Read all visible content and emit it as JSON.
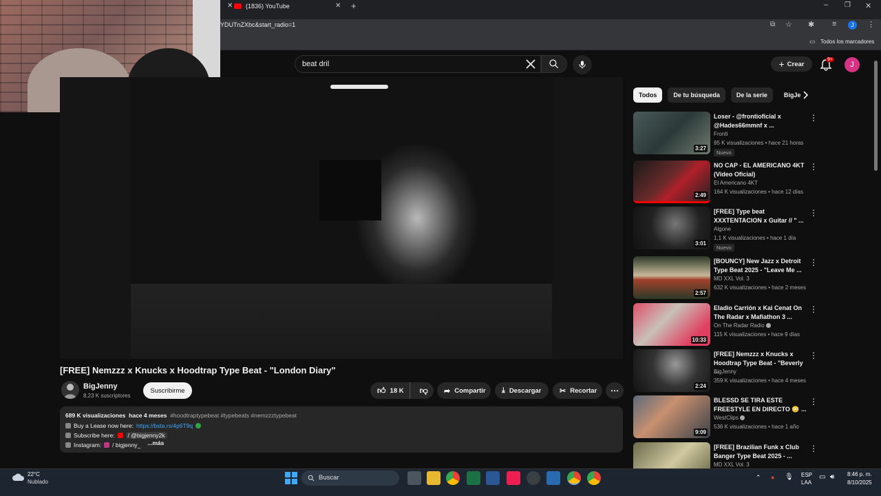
{
  "browser": {
    "tab_title": "(1836) YouTube",
    "url_fragment": "YDUTnZXbc&start_radio=1",
    "bookmarks_label": "Todos los marcadores",
    "profile_initial": "J"
  },
  "youtube": {
    "search_value": "beat dril",
    "create_label": "Crear",
    "notifications_badge": "9+",
    "avatar_initial": "J"
  },
  "video": {
    "title": "[FREE] Nemzzz x Knucks x Hoodtrap Type Beat - \"London Diary\"",
    "channel": "BigJenny",
    "subscribers": "8,23 K suscriptores",
    "subscribe_label": "Suscribirme",
    "likes": "18 K",
    "share_label": "Compartir",
    "download_label": "Descargar",
    "clip_label": "Recortar"
  },
  "description": {
    "views": "689 K visualizaciones",
    "date": "hace 4 meses",
    "tags": "#hoodtraptypebeat #typebeats #nemzzztypebeat",
    "line1_text": "Buy a Lease now here:",
    "line1_link": "https://bsta.rs/4p6T9q",
    "line2_text": "Subscribe here:",
    "line2_link": "/ @bigjenny2k",
    "line3_text": "Instagram:",
    "line3_link": "/ bigjenny_",
    "more": "...más"
  },
  "chips": [
    "Todos",
    "De tu búsqueda",
    "De la serie",
    "BigJe"
  ],
  "recommendations": [
    {
      "title": "Loser - @frontioficial x @Hades66mmnf x ...",
      "channel": "Fronti",
      "verified": false,
      "stats": "95 K visualizaciones • hace 21 horas",
      "duration": "3:27",
      "badge": "Nuevo"
    },
    {
      "title": "NO CAP - EL AMERICANO 4KT (Video Oficial)",
      "channel": "El Americano 4KT",
      "verified": false,
      "stats": "164 K visualizaciones • hace 12 días",
      "duration": "2:49",
      "badge": ""
    },
    {
      "title": "[FREE] Type beat XXXTENTACION x Guitar // \" ...",
      "channel": "Algone",
      "verified": false,
      "stats": "1,1 K visualizaciones • hace 1 día",
      "duration": "3:01",
      "badge": "Nuevo"
    },
    {
      "title": "[BOUNCY] New Jazz x Detroit Type Beat 2025 - \"Leave Me ...",
      "channel": "MD XXL Vol. 3",
      "verified": false,
      "stats": "632 K visualizaciones • hace 2 meses",
      "duration": "2:57",
      "badge": ""
    },
    {
      "title": "Eladio Carrión x Kai Cenat On The Radar x Mafiathon 3 ...",
      "channel": "On The Radar Radio",
      "verified": true,
      "stats": "115 K visualizaciones • hace 9 días",
      "duration": "10:33",
      "badge": ""
    },
    {
      "title": "[FREE] Nemzzz x Knucks x Hoodtrap Type Beat - \"Beverly ...",
      "channel": "BigJenny",
      "verified": false,
      "stats": "359 K visualizaciones • hace 4 meses",
      "duration": "2:24",
      "badge": ""
    },
    {
      "title": "BLESSD SE TIRA ESTE FREESTYLE EN DIRECTO 😳 ...",
      "channel": "WestClips",
      "verified": true,
      "stats": "536 K visualizaciones • hace 1 año",
      "duration": "9:09",
      "badge": ""
    },
    {
      "title": "[FREE] Brazilian Funk x Club Banger Type Beat 2025 - ...",
      "channel": "MD XXL Vol. 3",
      "verified": false,
      "stats": "",
      "duration": "",
      "badge": ""
    }
  ],
  "taskbar": {
    "weather_temp": "22°C",
    "weather_desc": "Nublado",
    "search_label": "Buscar",
    "lang1": "ESP",
    "lang2": "LAA",
    "time": "8:46 p. m.",
    "date": "8/10/2025"
  },
  "colors": {
    "accent_red": "#ff0000",
    "link_blue": "#3ea6ff",
    "avatar_pink": "#d63384"
  }
}
